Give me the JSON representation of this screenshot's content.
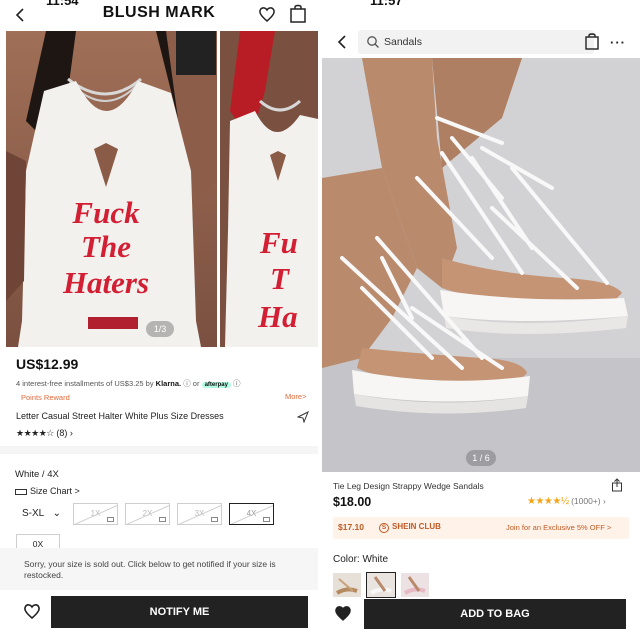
{
  "left": {
    "status": {
      "time": "11:54"
    },
    "header": {
      "brand": "BLUSH MARK"
    },
    "gallery": {
      "counter": "1/3",
      "print_text": "Fuck The Haters"
    },
    "product": {
      "price": "US$12.99",
      "installments_prefix": "4 interest-free installments of US$3.25 by",
      "installments_klarna": "Klarna.",
      "installments_or": "or",
      "installments_afterpay": "afterpay",
      "points_label": "Points Reward",
      "more_label": "More>",
      "title": "Letter Casual Street Halter White Plus Size Dresses",
      "rating_stars": "★★★★☆",
      "review_count": "(8)",
      "chevron": "›"
    },
    "options": {
      "selected_color_size": "White / 4X",
      "size_chart_label": "Size Chart >",
      "size_group": "S-XL",
      "size_group_chevron": "⌄",
      "sizes": [
        "1X",
        "2X",
        "3X",
        "4X"
      ],
      "selected_size": "4X",
      "extra_size": "0X"
    },
    "sold_out": {
      "message": "Sorry, your size is sold out. Click below to get notified if your size is restocked."
    },
    "footer": {
      "notify_label": "NOTIFY ME"
    }
  },
  "right": {
    "status": {
      "time": "11:57"
    },
    "search": {
      "value": "Sandals",
      "placeholder": "Sandals"
    },
    "header": {
      "more_label": "···"
    },
    "gallery": {
      "counter": "1 / 6"
    },
    "product": {
      "title": "Tie Leg Design Strappy Wedge Sandals",
      "price": "$18.00",
      "rating_stars": "★★★★½",
      "review_count": "(1000+)",
      "chevron": "›"
    },
    "club": {
      "price": "$17.10",
      "logo_letter": "S",
      "logo_text": "SHEIN CLUB",
      "cta": "Join for an Exclusive 5% OFF >"
    },
    "options": {
      "color_label": "Color: White"
    },
    "footer": {
      "add_label": "ADD TO BAG"
    }
  },
  "colors": {
    "accent_orange": "#e06a3a",
    "club_bg": "#fff3e9",
    "club_text": "#c05a25",
    "star_gold": "#f4a51c",
    "dress_print_red": "#d21f33",
    "button_black": "#222222"
  },
  "icons": [
    "back-arrow-icon",
    "heart-icon",
    "bag-icon",
    "share-icon",
    "search-icon",
    "ruler-icon",
    "mail-icon",
    "more-dots-icon"
  ]
}
